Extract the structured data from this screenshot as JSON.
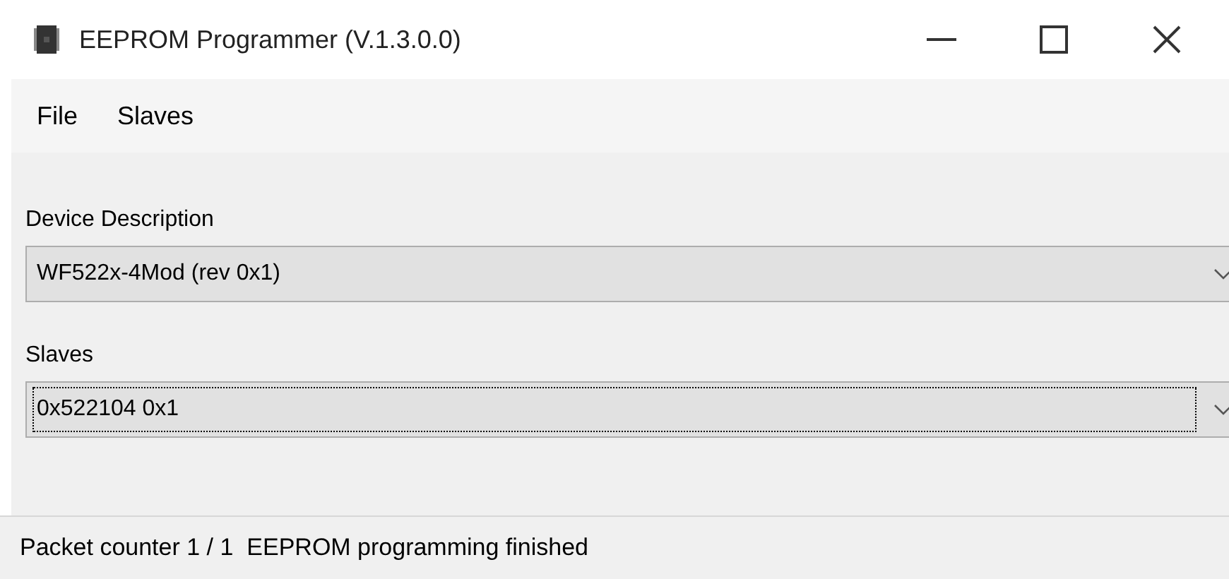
{
  "window": {
    "title": "EEPROM Programmer (V.1.3.0.0)"
  },
  "menu": [
    {
      "label": "File"
    },
    {
      "label": "Slaves"
    }
  ],
  "fields": [
    {
      "label": "Device Description",
      "value": "WF522x-4Mod (rev 0x1)",
      "focused": false
    },
    {
      "label": "Slaves",
      "value": "0x522104 0x1",
      "focused": true
    }
  ],
  "status_bar": {
    "text": "Packet counter 1 / 1  EEPROM programming finished"
  }
}
